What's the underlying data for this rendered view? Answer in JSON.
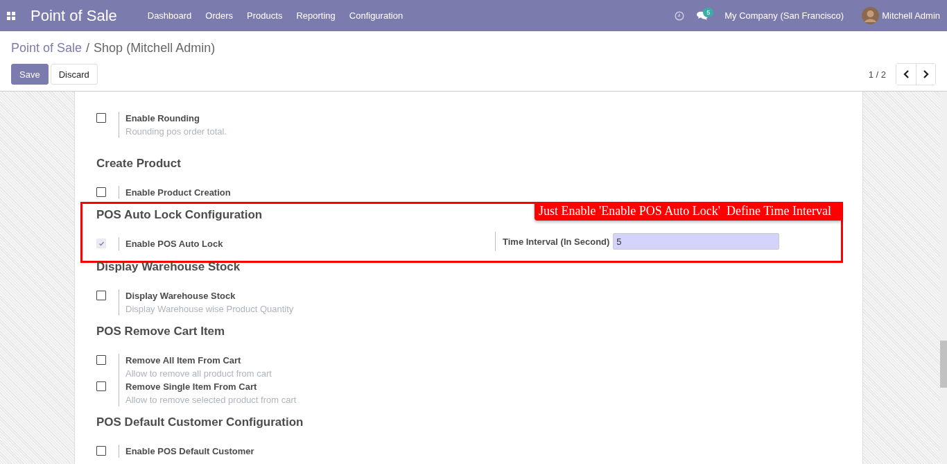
{
  "navbar": {
    "app_name": "Point of Sale",
    "menu": [
      "Dashboard",
      "Orders",
      "Products",
      "Reporting",
      "Configuration"
    ],
    "messages_count": "5",
    "company": "My Company (San Francisco)",
    "user": "Mitchell Admin"
  },
  "breadcrumb": [
    {
      "label": "Point of Sale",
      "kind": "link"
    },
    {
      "label": "Shop (Mitchell Admin)",
      "kind": "current"
    }
  ],
  "breadcrumb_separator": "/",
  "buttons": [
    {
      "label": "Save",
      "kind": "primary"
    },
    {
      "label": "Discard",
      "kind": "secondary"
    }
  ],
  "pager": {
    "value": "1 / 2"
  },
  "sections": [
    {
      "settings": [
        {
          "title": "Enable Rounding",
          "description": "Rounding pos order total.",
          "checked": false
        }
      ]
    },
    {
      "heading": "Create Product",
      "settings": [
        {
          "title": "Enable Product Creation",
          "checked": false
        }
      ]
    },
    {
      "heading": "POS Auto Lock Configuration",
      "settings": [
        {
          "title": "Enable POS Auto Lock",
          "checked": true,
          "field": {
            "label": "Time Interval (In Second)",
            "value": "5"
          }
        }
      ],
      "annotation": {
        "text": "Just Enable 'Enable POS Auto Lock'  Define Time Interval"
      }
    },
    {
      "heading": "Display Warehouse Stock",
      "settings": [
        {
          "title": "Display Warehouse Stock",
          "description": "Display Warehouse wise Product Quantity",
          "checked": false
        }
      ]
    },
    {
      "heading": "POS Remove Cart Item",
      "settings": [
        {
          "title": "Remove All Item From Cart",
          "description": "Allow to remove all product from cart",
          "checked": false
        },
        {
          "title": "Remove Single Item From Cart",
          "description": "Allow to remove selected product from cart",
          "checked": false
        }
      ]
    },
    {
      "heading": "POS Default Customer Configuration",
      "settings": [
        {
          "title": "Enable POS Default Customer",
          "checked": false
        }
      ]
    }
  ]
}
